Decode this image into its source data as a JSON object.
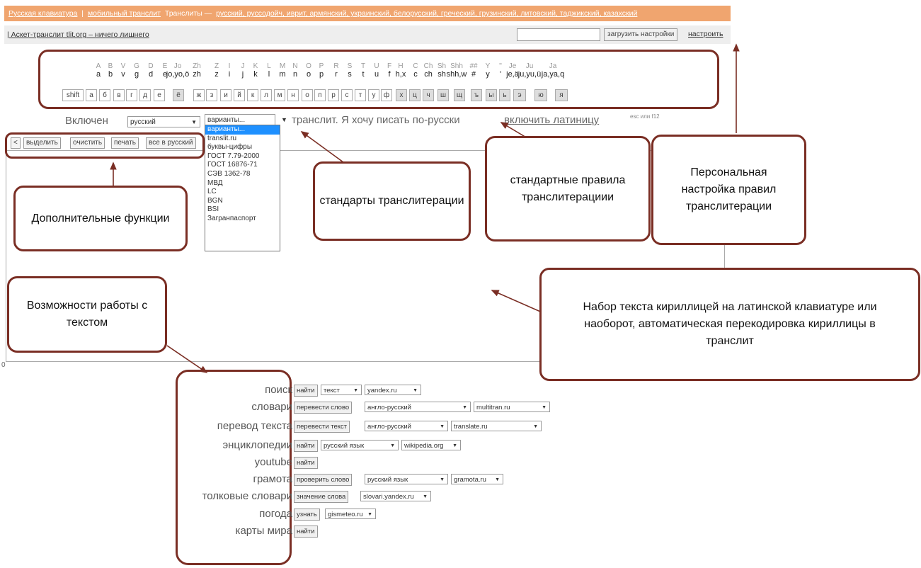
{
  "top_bar": {
    "russian_keyboard": "Русская клавиатура",
    "sep": " | ",
    "mobile_translit": "мобильный транслит",
    "translits_prefix": "  Транслиты — ",
    "languages": "русский, руссодойч, иврит, армянский, украинский, белорусский, греческий, грузинский, литовский, таджикский, казахский"
  },
  "second_bar": {
    "link": "| Аскет-транслит tlit.org – ничего лишнего",
    "load_settings": "загрузить настройки",
    "configure": "настроить"
  },
  "keyboard": {
    "latin_upper": [
      "A",
      "B",
      "V",
      "G",
      "D",
      "E",
      "Jo",
      "Zh",
      "Z",
      "I",
      "J",
      "K",
      "L",
      "M",
      "N",
      "O",
      "P",
      "R",
      "S",
      "T",
      "U",
      "F",
      "H",
      "C",
      "Ch",
      "Sh",
      "Shh",
      "##",
      "Y",
      "''",
      "Je",
      "Ju",
      "Ja"
    ],
    "latin_lower": [
      "a",
      "b",
      "v",
      "g",
      "d",
      "e",
      "jo,yo,ö",
      "zh",
      "z",
      "i",
      "j",
      "k",
      "l",
      "m",
      "n",
      "o",
      "p",
      "r",
      "s",
      "t",
      "u",
      "f",
      "h,x",
      "c",
      "ch",
      "sh",
      "shh,w",
      "#",
      "y",
      "'",
      "je,ä",
      "ju,yu,ü",
      "ja,ya,q"
    ],
    "shift": "shift",
    "cyrillic": [
      "а",
      "б",
      "в",
      "г",
      "д",
      "е",
      "ё",
      "ж",
      "з",
      "и",
      "й",
      "к",
      "л",
      "м",
      "н",
      "о",
      "п",
      "р",
      "с",
      "т",
      "у",
      "ф",
      "х",
      "ц",
      "ч",
      "ш",
      "щ",
      "ъ",
      "ы",
      "ь",
      "э",
      "ю",
      "я"
    ]
  },
  "mode": {
    "enabled": "Включен",
    "language": "русский",
    "variants": "варианты...",
    "sentence": "транслит. Я хочу писать по-русски",
    "enable_latin": "включить латиницу",
    "hint": "esc или f12"
  },
  "variants_options": [
    "варианты...",
    "translit.ru",
    "буквы-цифры",
    "ГОСТ 7.79-2000",
    "ГОСТ 16876-71",
    "СЭВ 1362-78",
    "МВД",
    "LC",
    "BGN",
    "BSI",
    "Загранпаспорт"
  ],
  "toolbar": {
    "back": "<",
    "select": "выделить",
    "clear": "очистить",
    "print": "печать",
    "all_russian": "все в русский"
  },
  "callouts": {
    "extra_functions": "Дополнительные функции",
    "standards": "стандарты транслитерации",
    "standard_rules": "стандартные правила транслитерациии",
    "personal": "Персональная настройка правил транслитерации",
    "typing": "Набор текста кириллицей на латинской клавиатуре или наоборот, автоматическая перекодировка кириллицы в транслит",
    "text_features": "Возможности работы с текстом"
  },
  "search_rows": [
    {
      "label": "поиск",
      "button": "найти",
      "sel1": "текст",
      "sel2": "yandex.ru"
    },
    {
      "label": "словари",
      "button": "перевести слово",
      "sel1": "англо-русский",
      "sel2": "multitran.ru"
    },
    {
      "label": "перевод текста",
      "button": "перевести текст",
      "sel1": "англо-русский",
      "sel2": "translate.ru"
    },
    {
      "label": "энциклопедии",
      "button": "найти",
      "sel1": "русский язык",
      "sel2": "wikipedia.org"
    },
    {
      "label": "youtube",
      "button": "найти"
    },
    {
      "label": "грамота",
      "button": "проверить слово",
      "sel1": "русский язык",
      "sel2": "gramota.ru"
    },
    {
      "label": "толковые словари",
      "button": "значение слова",
      "sel1": "slovari.yandex.ru"
    },
    {
      "label": "погода",
      "button": "узнать",
      "sel1": "gismeteo.ru"
    },
    {
      "label": "карты мира",
      "button": "найти"
    }
  ],
  "char_counter": "0"
}
